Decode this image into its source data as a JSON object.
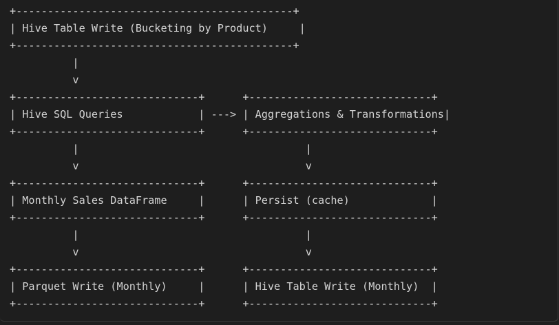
{
  "diagram": {
    "lines": [
      "+--------------------------------------------+",
      "| Hive Table Write (Bucketing by Product)     |",
      "+--------------------------------------------+",
      "          |",
      "          v",
      "+-----------------------------+      +-----------------------------+",
      "| Hive SQL Queries            | ---> | Aggregations & Transformations|",
      "+-----------------------------+      +-----------------------------+",
      "          |                                    |",
      "          v                                    v",
      "+-----------------------------+      +-----------------------------+",
      "| Monthly Sales DataFrame     |      | Persist (cache)             |",
      "+-----------------------------+      +-----------------------------+",
      "          |                                    |",
      "          v                                    v",
      "+-----------------------------+      +-----------------------------+",
      "| Parquet Write (Monthly)     |      | Hive Table Write (Monthly)  |",
      "+-----------------------------+      +-----------------------------+"
    ]
  }
}
